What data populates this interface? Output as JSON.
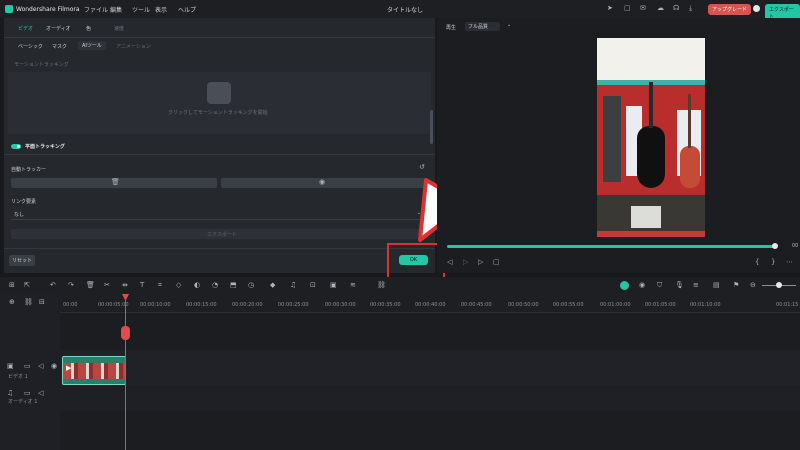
{
  "app": {
    "name": "Wondershare Filmora",
    "doc_title": "タイトルなし"
  },
  "menu": [
    "ファイル",
    "編集",
    "ツール",
    "表示",
    "ヘルプ"
  ],
  "top_right": {
    "upgrade": "アップグレード",
    "export": "エクスポート"
  },
  "tabs": {
    "video": "ビデオ",
    "audio": "オーディオ",
    "color": "色",
    "speed": "速度"
  },
  "subtabs": [
    "ベーシック",
    "マスク",
    "AIツール",
    "アニメーション"
  ],
  "motion": {
    "header": "モーショントラッキング",
    "hint": "クリックしてモーショントラッキングを開始"
  },
  "planar": {
    "title": "平面トラッキング",
    "auto_tracker": "自動トラッカー",
    "link_element": "リンク要素",
    "select_value": "なし",
    "export_button": "エクスポート"
  },
  "reset": "リセット",
  "ok": "OK",
  "player": {
    "label": "再生",
    "quality": "フル品質"
  },
  "timeline": {
    "ruler": [
      "00:00",
      "00:00:05:00",
      "00:00:10:00",
      "00:00:15:00",
      "00:00:20:00",
      "00:00:25:00",
      "00:00:30:00",
      "00:00:35:00",
      "00:00:40:00",
      "00:00:45:00",
      "00:00:50:00",
      "00:00:55:00",
      "00:01:00:00",
      "00:01:05:00",
      "00:01:10:00",
      "00:01:15"
    ],
    "video_track": "ビデオ 1",
    "audio_track": "オーディオ 1"
  },
  "colors": {
    "accent": "#22c7a5",
    "playhead": "#e04c4c",
    "highlight": "#e03131",
    "upgrade": "#d9534f"
  }
}
